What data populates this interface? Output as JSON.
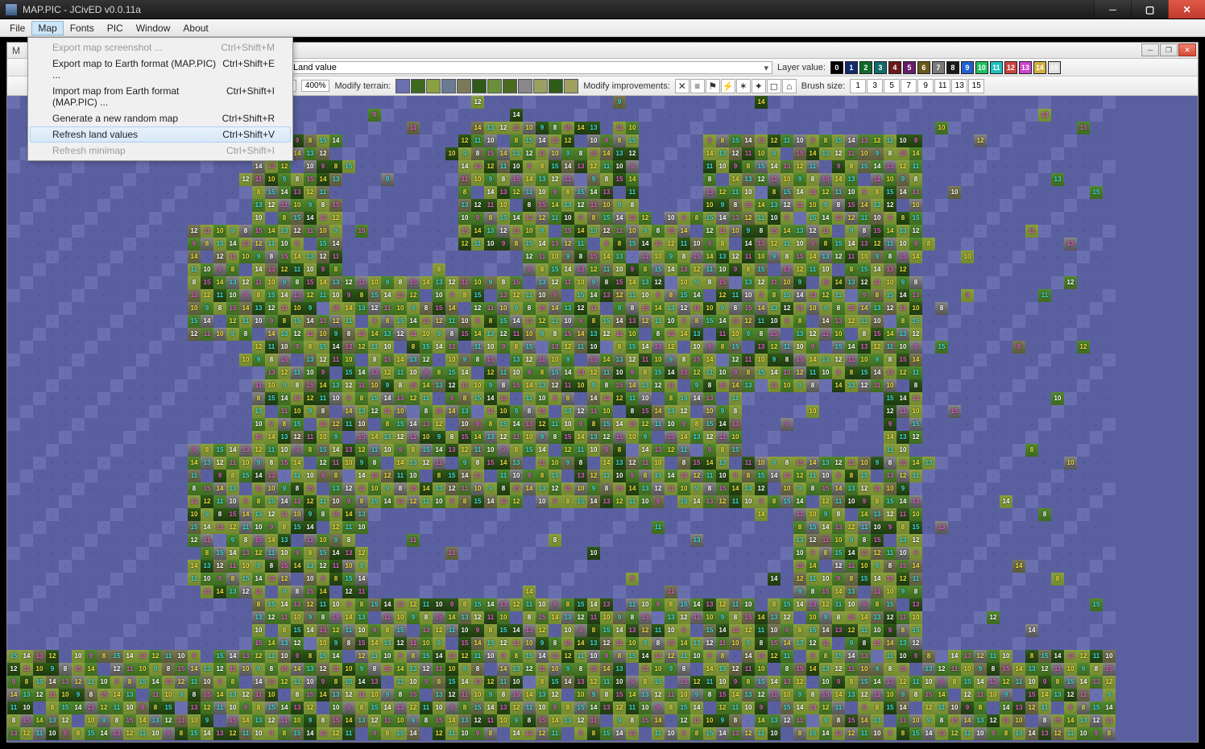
{
  "window": {
    "title": "MAP.PIC - JCivED v0.0.11a"
  },
  "menubar": [
    "File",
    "Map",
    "Fonts",
    "PIC",
    "Window",
    "About"
  ],
  "active_menu_index": 1,
  "dropdown": [
    {
      "label": "Export map screenshot ...",
      "shortcut": "Ctrl+Shift+M",
      "disabled": true
    },
    {
      "label": "Export map to Earth format (MAP.PIC) ...",
      "shortcut": "Ctrl+Shift+E",
      "disabled": false
    },
    {
      "label": "Import map from Earth format (MAP.PIC) ...",
      "shortcut": "Ctrl+Shift+I",
      "disabled": false
    },
    {
      "label": "Generate a new random map",
      "shortcut": "Ctrl+Shift+R",
      "disabled": false
    },
    {
      "label": "Refresh land values",
      "shortcut": "Ctrl+Shift+V",
      "disabled": false,
      "hover": true
    },
    {
      "label": "Refresh minimap",
      "shortcut": "Ctrl+Shift+I",
      "disabled": true
    }
  ],
  "doc": {
    "tab_initial": "M",
    "title": ""
  },
  "layer": {
    "selected": "Land value",
    "label": "Layer value:",
    "values": [
      "0",
      "1",
      "2",
      "3",
      "4",
      "5",
      "6",
      "7",
      "8",
      "9",
      "10",
      "11",
      "12",
      "13",
      "14",
      "15"
    ]
  },
  "swatch_colors": [
    "#000000",
    "#102a6a",
    "#0f6a2a",
    "#0f6a6a",
    "#6a1a1a",
    "#6a1a6a",
    "#6a5a1a",
    "#7a7a7a",
    "#1a1a1a",
    "#2060d0",
    "#20c060",
    "#20c0c0",
    "#d04040",
    "#d040d0",
    "#d0b040",
    "#e0e0e0"
  ],
  "zoom": {
    "values": [
      "%",
      "400%"
    ],
    "selected_index": 1
  },
  "terrain_label": "Modify terrain:",
  "terrain_colors": [
    "#6a6fb0",
    "#3e6a20",
    "#8aa040",
    "#6a7a90",
    "#7a7a58",
    "#2f5a18",
    "#6a903a",
    "#4a6a20",
    "#888888",
    "#9aa060",
    "#2f5a18",
    "#a0a060"
  ],
  "improvements_label": "Modify improvements:",
  "improvements": [
    "✕",
    "≡",
    "⚑",
    "⚡",
    "✶",
    "✦",
    "◻",
    "⌂"
  ],
  "brush_label": "Brush size:",
  "brush_sizes": [
    "1",
    "3",
    "5",
    "7",
    "9",
    "11",
    "13",
    "15"
  ]
}
